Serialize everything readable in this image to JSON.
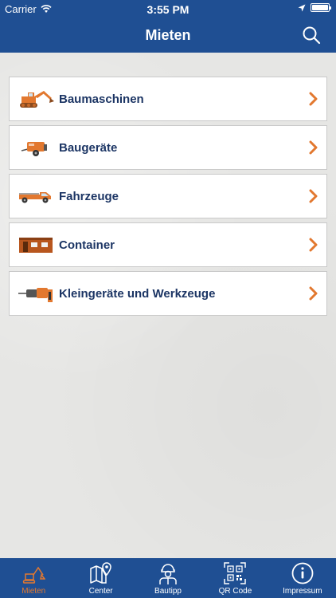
{
  "status": {
    "carrier": "Carrier",
    "time": "3:55 PM",
    "battery_level": 1.0
  },
  "header": {
    "title": "Mieten"
  },
  "categories": [
    {
      "label": "Baumaschinen",
      "icon": "excavator-icon"
    },
    {
      "label": "Baugeräte",
      "icon": "compressor-icon"
    },
    {
      "label": "Fahrzeuge",
      "icon": "pickup-truck-icon"
    },
    {
      "label": "Container",
      "icon": "container-icon"
    },
    {
      "label": "Kleingeräte und Werkzeuge",
      "icon": "drill-hammer-icon"
    }
  ],
  "tabs": [
    {
      "label": "Mieten",
      "icon": "excavator-icon",
      "active": true
    },
    {
      "label": "Center",
      "icon": "map-pin-icon",
      "active": false
    },
    {
      "label": "Bautipp",
      "icon": "worker-icon",
      "active": false
    },
    {
      "label": "QR Code",
      "icon": "qr-code-icon",
      "active": false
    },
    {
      "label": "Impressum",
      "icon": "info-icon",
      "active": false
    }
  ],
  "colors": {
    "primary": "#1f4f93",
    "accent": "#e2782f",
    "text": "#1c3564"
  }
}
